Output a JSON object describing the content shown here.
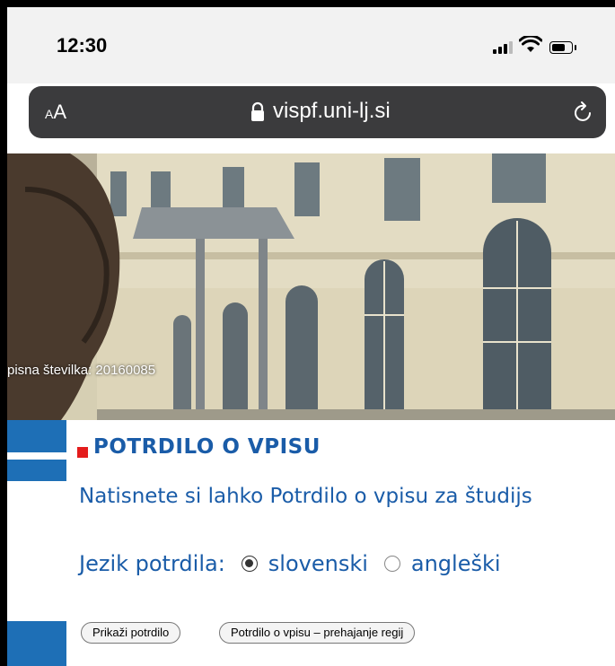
{
  "status_bar": {
    "time": "12:30"
  },
  "browser": {
    "text_size_button": "AA",
    "url": "vispf.uni-lj.si"
  },
  "hero": {
    "caption": "pisna številka: 20160085"
  },
  "main": {
    "title": "POTRDILO O VPISU",
    "description": "Natisnete si lahko Potrdilo o vpisu za študijs",
    "language_label": "Jezik potrdila:",
    "language_options": [
      {
        "label": "slovenski",
        "selected": true
      },
      {
        "label": "angleški",
        "selected": false
      }
    ],
    "buttons": {
      "show": "Prikaži potrdilo",
      "transit": "Potrdilo o vpisu – prehajanje regij"
    }
  },
  "colors": {
    "accent_blue": "#1e6fb6",
    "title_blue": "#1a5ca8",
    "marker_red": "#e41c1c"
  }
}
